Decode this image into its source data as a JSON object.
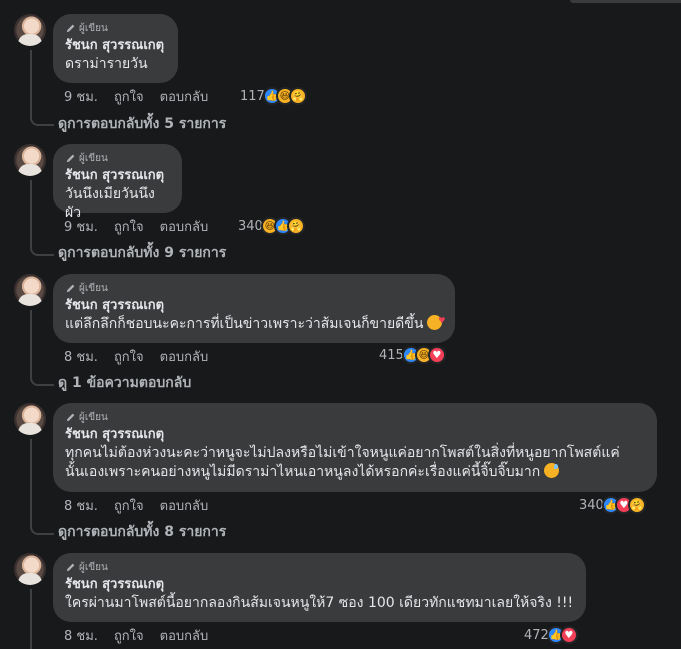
{
  "author_badge": "ผู้เขียน",
  "comments": [
    {
      "name": "รัชนก สุวรรณเกตุ",
      "text": [
        "ดราม่ารายวัน"
      ],
      "time": "9 ชม.",
      "like": "ถูกใจ",
      "reply": "ตอบกลับ",
      "count": "117",
      "reactions": [
        "like-icon",
        "haha-icon",
        "care-icon"
      ],
      "view_replies": "ดูการตอบกลับทั้ง 5 รายการ"
    },
    {
      "name": "รัชนก สุวรรณเกตุ",
      "text": [
        "วันนึงเมียวันนึงผัว"
      ],
      "time": "9 ชม.",
      "like": "ถูกใจ",
      "reply": "ตอบกลับ",
      "count": "340",
      "reactions": [
        "haha-icon",
        "like-icon",
        "care-icon"
      ],
      "view_replies": "ดูการตอบกลับทั้ง 9 รายการ"
    },
    {
      "name": "รัชนก สุวรรณเกตุ",
      "text": [
        "แต่ลึกลึกก็ชอบนะคะการที่เป็นข่าวเพราะว่าส้มเจนก็ขายดีขึ้น"
      ],
      "time": "8 ชม.",
      "like": "ถูกใจ",
      "reply": "ตอบกลับ",
      "count": "415",
      "reactions": [
        "like-icon",
        "haha-icon",
        "love-icon"
      ],
      "view_replies": "ดู 1 ข้อความตอบกลับ"
    },
    {
      "name": "รัชนก สุวรรณเกตุ",
      "text": [
        "ทุกคนไม่ต้องห่วงนะคะว่าหนูจะไม่ปลงหรือไม่เข้าใจหนูแค่อยากโพสต์ในสิ่งที่หนูอยากโพสต์แค่",
        "นั้นเองเพราะคนอย่างหนูไม่มีดราม่าไหนเอาหนูลงได้หรอกค่ะเรื่องแค่นี้จิ๊บจิ๊บมาก"
      ],
      "time": "8 ชม.",
      "like": "ถูกใจ",
      "reply": "ตอบกลับ",
      "count": "340",
      "reactions": [
        "like-icon",
        "love-icon",
        "care-icon"
      ],
      "view_replies": "ดูการตอบกลับทั้ง 8 รายการ"
    },
    {
      "name": "รัชนก สุวรรณเกตุ",
      "text": [
        "ใครผ่านมาโพสต์นี้อยากลองกินส้มเจนหนูให้7 ซอง 100 เดียวทักแชทมาเลยให้จริง !!!"
      ],
      "time": "8 ชม.",
      "like": "ถูกใจ",
      "reply": "ตอบกลับ",
      "count": "472",
      "reactions": [
        "like-icon",
        "love-icon"
      ],
      "view_replies": ""
    }
  ],
  "colors": {
    "background": "#18191a",
    "bubble": "#3a3b3c",
    "like": "#2d88ff",
    "love": "#f33e58",
    "haha": "#f7b125"
  }
}
